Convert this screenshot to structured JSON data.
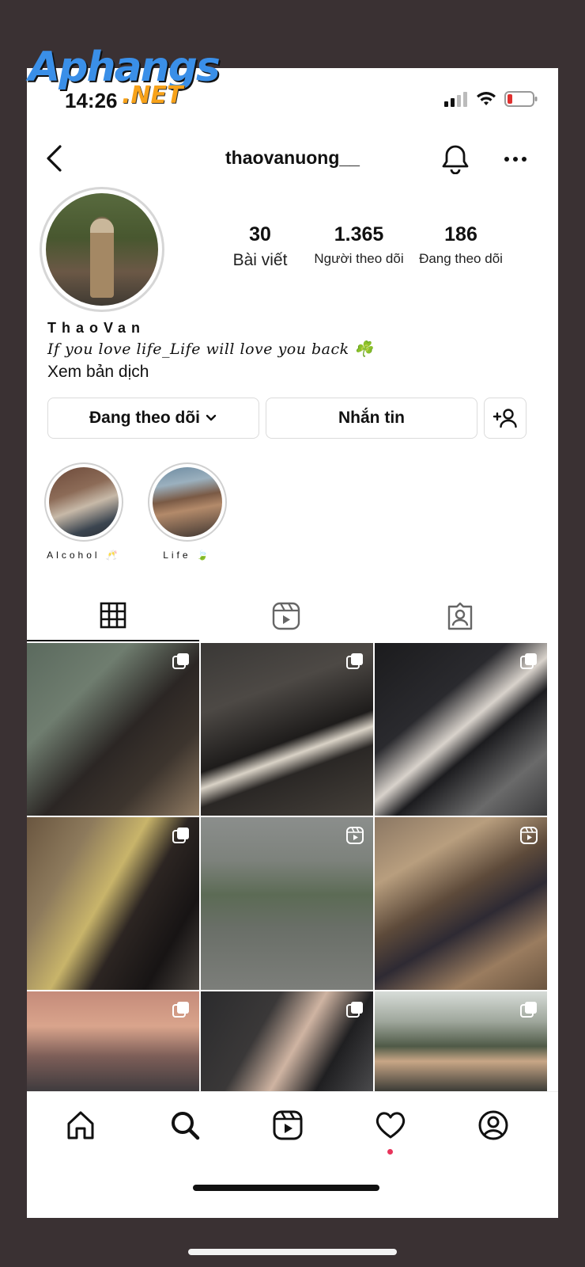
{
  "watermark": {
    "brand": "Aphangs",
    "suffix": ".NET"
  },
  "status_bar": {
    "time": "14:26"
  },
  "header": {
    "username": "thaovanuong__"
  },
  "profile": {
    "stats": [
      {
        "value": "30",
        "label": "Bài viết"
      },
      {
        "value": "1.365",
        "label": "Người theo dõi"
      },
      {
        "value": "186",
        "label": "Đang theo dõi"
      }
    ],
    "display_name": "ThaoVan",
    "bio": "If you love life_Life will love you back ☘️",
    "translate_link": "Xem bản dịch"
  },
  "actions": {
    "following_label": "Đang theo dõi",
    "message_label": "Nhắn tin"
  },
  "highlights": [
    {
      "label": "Alcohol 🥂"
    },
    {
      "label": "Life 🍃"
    }
  ],
  "tabs": [
    "grid-icon",
    "reels-icon",
    "tagged-icon"
  ],
  "grid": {
    "posts": [
      {
        "badge": "carousel-icon"
      },
      {
        "badge": "carousel-icon"
      },
      {
        "badge": "carousel-icon"
      },
      {
        "badge": "carousel-icon"
      },
      {
        "badge": "reel-icon"
      },
      {
        "badge": "reel-icon"
      },
      {
        "badge": "carousel-icon"
      },
      {
        "badge": "carousel-icon"
      },
      {
        "badge": "carousel-icon"
      }
    ]
  },
  "bottom_nav": [
    "home-icon",
    "search-icon",
    "reels-icon",
    "activity-heart-icon",
    "profile-icon"
  ],
  "colors": {
    "notification_dot": "#e8345b",
    "border": "#dbdbdb"
  }
}
